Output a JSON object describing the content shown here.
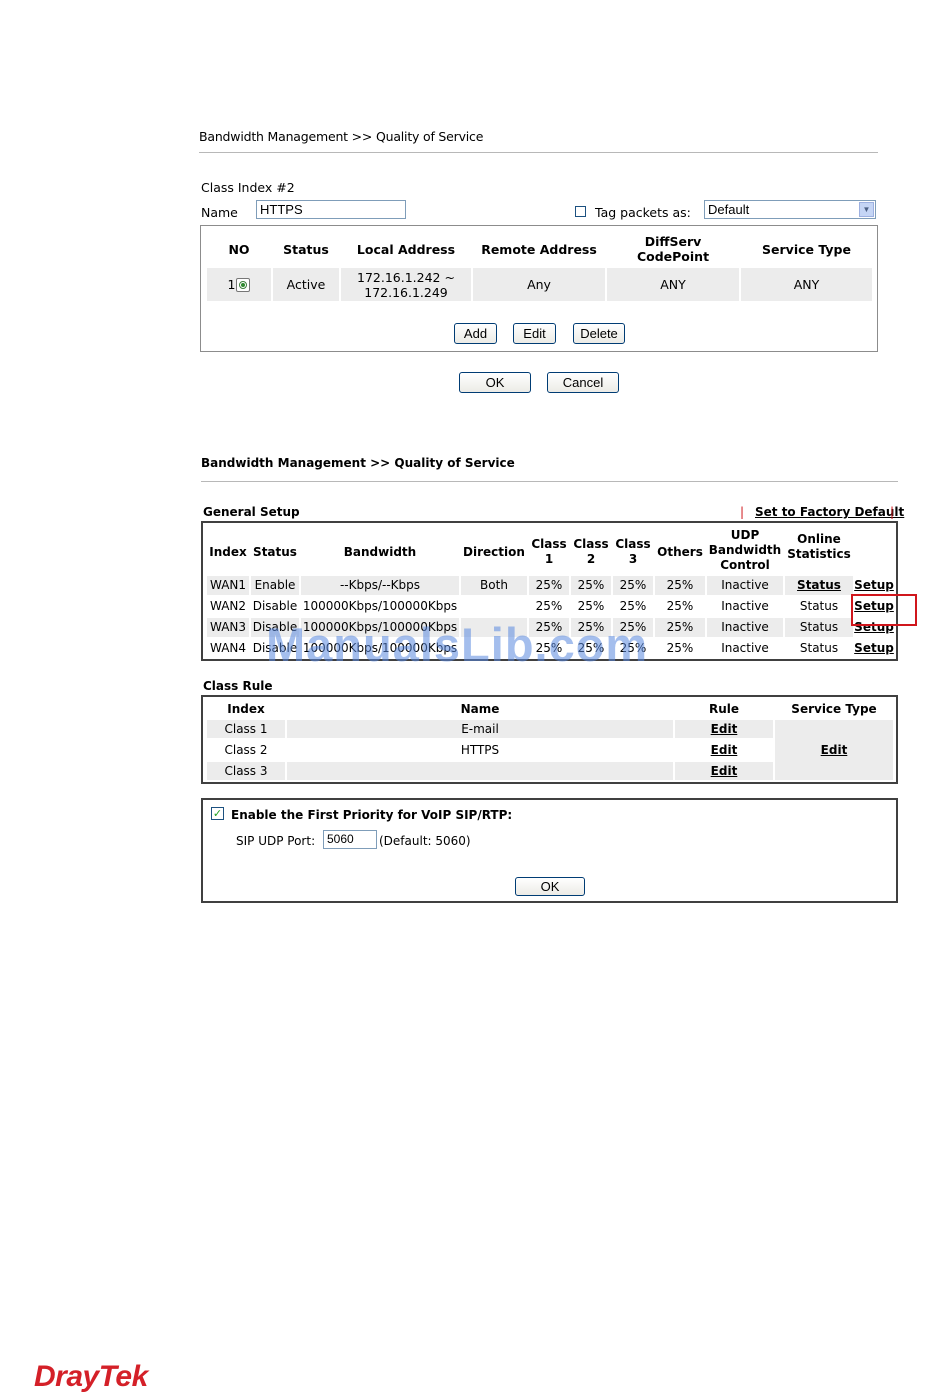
{
  "top": {
    "breadcrumb": "Bandwidth Management >> Quality of Service",
    "class_index": "Class Index #2",
    "name_label": "Name",
    "name_value": "HTTPS",
    "tag_label": "Tag packets as:",
    "tag_value": "Default",
    "table": {
      "headers": [
        "NO",
        "Status",
        "Local Address",
        "Remote Address",
        "DiffServ CodePoint",
        "Service Type"
      ],
      "row": {
        "no": "1",
        "status": "Active",
        "local_line1": "172.16.1.242 ~",
        "local_line2": "172.16.1.249",
        "remote": "Any",
        "diffserv": "ANY",
        "service": "ANY"
      }
    },
    "buttons": {
      "add": "Add",
      "edit": "Edit",
      "delete": "Delete",
      "ok": "OK",
      "cancel": "Cancel"
    }
  },
  "bottom": {
    "breadcrumb": "Bandwidth Management >> Quality of Service",
    "general_setup": "General Setup",
    "factory_default": "Set to Factory Default",
    "headers": {
      "index": "Index",
      "status": "Status",
      "bandwidth": "Bandwidth",
      "direction": "Direction",
      "class1_a": "Class",
      "class1_b": "1",
      "class2_a": "Class",
      "class2_b": "2",
      "class3_a": "Class",
      "class3_b": "3",
      "others": "Others",
      "udp_a": "UDP",
      "udp_b": "Bandwidth",
      "udp_c": "Control",
      "online_a": "Online",
      "online_b": "Statistics"
    },
    "wan_rows": [
      {
        "index": "WAN1",
        "status": "Enable",
        "bandwidth": "--Kbps/--Kbps",
        "direction": "Both",
        "c1": "25%",
        "c2": "25%",
        "c3": "25%",
        "others": "25%",
        "udp": "Inactive",
        "stat": "Status",
        "setup": "Setup"
      },
      {
        "index": "WAN2",
        "status": "Disable",
        "bandwidth": "100000Kbps/100000Kbps",
        "direction": "",
        "c1": "25%",
        "c2": "25%",
        "c3": "25%",
        "others": "25%",
        "udp": "Inactive",
        "stat": "Status",
        "setup": "Setup"
      },
      {
        "index": "WAN3",
        "status": "Disable",
        "bandwidth": "100000Kbps/100000Kbps",
        "direction": "",
        "c1": "25%",
        "c2": "25%",
        "c3": "25%",
        "others": "25%",
        "udp": "Inactive",
        "stat": "Status",
        "setup": "Setup"
      },
      {
        "index": "WAN4",
        "status": "Disable",
        "bandwidth": "100000Kbps/100000Kbps",
        "direction": "",
        "c1": "25%",
        "c2": "25%",
        "c3": "25%",
        "others": "25%",
        "udp": "Inactive",
        "stat": "Status",
        "setup": "Setup"
      }
    ],
    "class_rule": "Class Rule",
    "class_headers": {
      "index": "Index",
      "name": "Name",
      "rule": "Rule",
      "service": "Service Type"
    },
    "class_rows": [
      {
        "index": "Class 1",
        "name": "E-mail",
        "rule": "Edit"
      },
      {
        "index": "Class 2",
        "name": "HTTPS",
        "rule": "Edit"
      },
      {
        "index": "Class 3",
        "name": "",
        "rule": "Edit"
      }
    ],
    "service_edit": "Edit",
    "voip_label": "Enable the First Priority for VoIP SIP/RTP:",
    "sip_label": "SIP UDP Port:",
    "sip_value": "5060",
    "sip_default": "(Default: 5060)",
    "ok": "OK"
  },
  "watermark": "ManualsLib.com",
  "logo": "DrayTek",
  "colors": {
    "highlight": "#d0161c",
    "logo": "#d42028",
    "watermark": "#5b8ae0"
  }
}
